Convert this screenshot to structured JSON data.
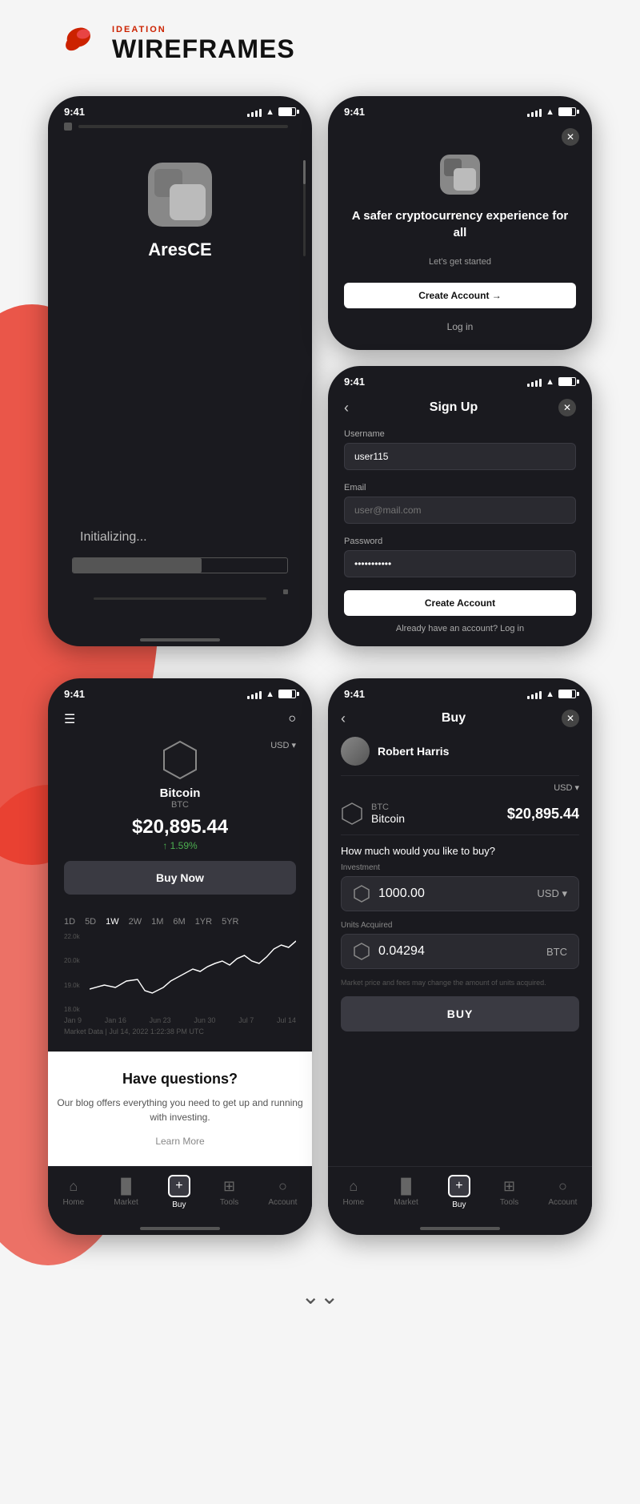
{
  "header": {
    "ideation_label": "IDEATION",
    "wireframes_label": "WIREFRAMES"
  },
  "splash_screen": {
    "time": "9:41",
    "app_name": "AresCE",
    "initializing_text": "Initializing...",
    "progress_pct": 60
  },
  "welcome_screen": {
    "time": "9:41",
    "title": "A safer cryptocurrency experience for all",
    "tagline": "Let's get started",
    "create_account_btn": "Create Account →",
    "login_btn": "Log in"
  },
  "signup_screen": {
    "time": "9:41",
    "screen_title": "Sign Up",
    "username_label": "Username",
    "username_placeholder": "user115",
    "email_label": "Email",
    "email_placeholder": "user@mail.com",
    "password_label": "Password",
    "password_value": "***********",
    "create_btn": "Create Account",
    "already_text": "Already have an account?",
    "login_link": "Log in"
  },
  "market_screen": {
    "time": "9:41",
    "currency": "USD ▾",
    "coin_name": "Bitcoin",
    "coin_symbol": "BTC",
    "coin_price": "$20,895.44",
    "coin_change": "↑ 1.59%",
    "buy_now_btn": "Buy Now",
    "chart_tabs": [
      "1D",
      "5D",
      "1W",
      "2W",
      "1M",
      "6M",
      "1YR",
      "5YR"
    ],
    "active_tab": "1W",
    "chart_labels": [
      "Jan 9",
      "Jan 16",
      "Jun 23",
      "Jun 30",
      "Jul 7",
      "Jul 14"
    ],
    "market_data_text": "Market Data | Jul 14, 2022 1:22:38 PM UTC",
    "blog_title": "Have questions?",
    "blog_desc": "Our blog offers everything you need to get up and running with investing.",
    "learn_more": "Learn More",
    "nav": {
      "home": "Home",
      "market": "Market",
      "buy": "Buy",
      "tools": "Tools",
      "account": "Account"
    }
  },
  "buy_screen": {
    "time": "9:41",
    "screen_title": "Buy",
    "user_name": "Robert Harris",
    "currency": "USD ▾",
    "coin_label": "BTC",
    "coin_name": "Bitcoin",
    "coin_price": "$20,895.44",
    "question": "How much would you like to buy?",
    "investment_label": "Investment",
    "investment_value": "1000.00",
    "investment_currency": "USD ▾",
    "units_label": "Units Acquired",
    "units_value": "0.04294",
    "units_currency": "BTC",
    "buy_btn": "BUY",
    "nav": {
      "home": "Home",
      "market": "Market",
      "buy": "Buy",
      "tools": "Tools",
      "account": "Account"
    }
  },
  "footer": {
    "chevron": "⌄⌄"
  }
}
